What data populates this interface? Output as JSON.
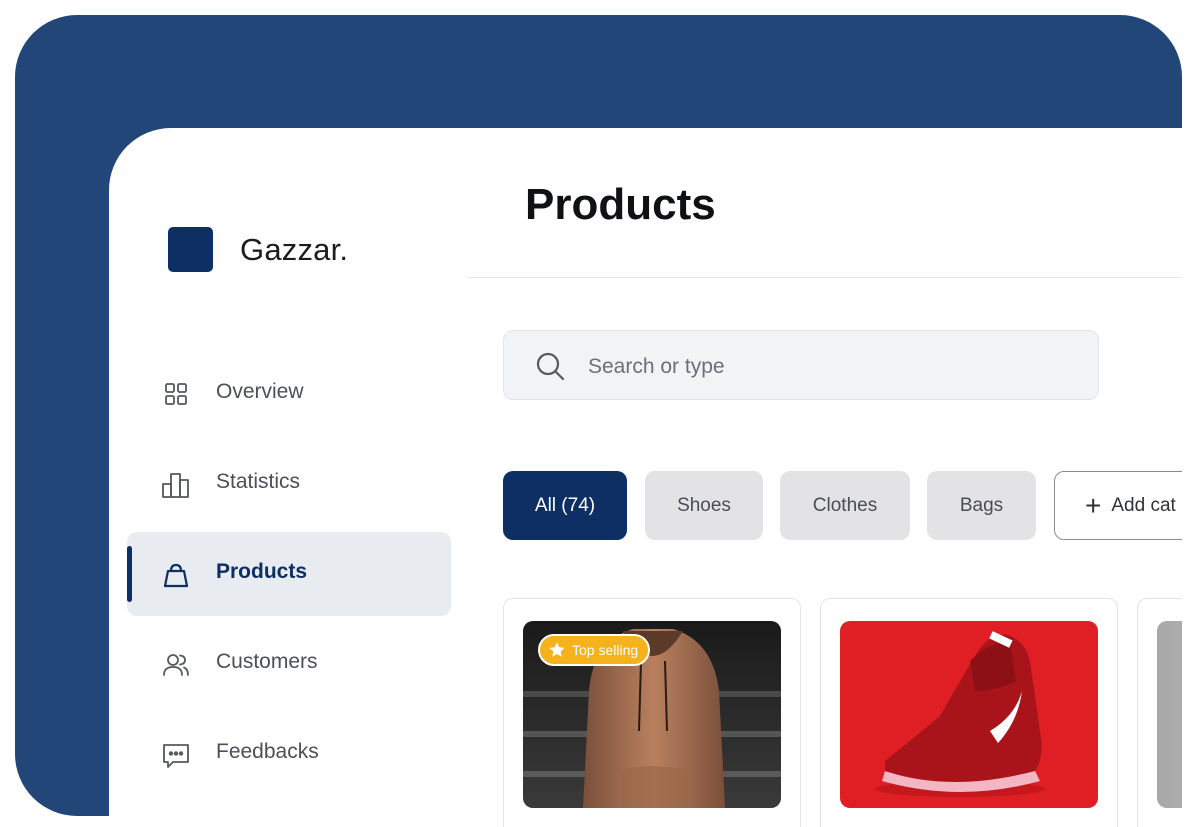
{
  "brand": {
    "name": "Gazzar."
  },
  "sidebar": {
    "items": [
      {
        "label": "Overview",
        "icon": "grid-icon",
        "active": false
      },
      {
        "label": "Statistics",
        "icon": "bar-chart-icon",
        "active": false
      },
      {
        "label": "Products",
        "icon": "shopping-bag-icon",
        "active": true
      },
      {
        "label": "Customers",
        "icon": "users-icon",
        "active": false
      },
      {
        "label": "Feedbacks",
        "icon": "message-icon",
        "active": false
      }
    ]
  },
  "main": {
    "title": "Products",
    "search": {
      "placeholder": "Search or type"
    },
    "filters": [
      {
        "label": "All (74)",
        "active": true
      },
      {
        "label": "Shoes",
        "active": false
      },
      {
        "label": "Clothes",
        "active": false
      },
      {
        "label": "Bags",
        "active": false
      }
    ],
    "add_category_label": "Add cat",
    "products": [
      {
        "badge": "Top selling",
        "image": "hoodie-photo"
      },
      {
        "image": "red-sneaker-photo"
      },
      {
        "image": "gray-product-photo"
      }
    ]
  },
  "colors": {
    "frame": "#224677",
    "accent": "#0d2f63",
    "badge": "#f6b21a",
    "active_bg": "#e8ebf0"
  }
}
